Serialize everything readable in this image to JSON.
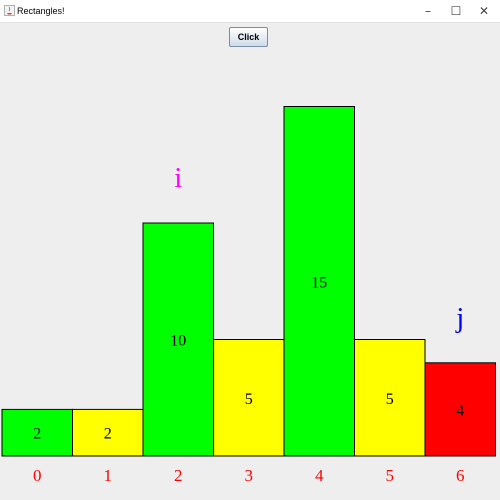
{
  "window": {
    "title": "Rectangles!",
    "minimize_glyph": "–",
    "maximize_glyph": "☐",
    "close_glyph": "✕"
  },
  "toolbar": {
    "click_label": "Click"
  },
  "colors": {
    "green": "#00ff00",
    "yellow": "#ffff00",
    "red": "#ff0000",
    "index_label": "#ff0000",
    "pointer_i": "#ff00ff",
    "pointer_j": "#0000ff",
    "bar_text": "#000000"
  },
  "bars": [
    {
      "index": "0",
      "value": 2,
      "color": "green"
    },
    {
      "index": "1",
      "value": 2,
      "color": "yellow"
    },
    {
      "index": "2",
      "value": 10,
      "color": "green"
    },
    {
      "index": "3",
      "value": 5,
      "color": "yellow"
    },
    {
      "index": "4",
      "value": 15,
      "color": "green"
    },
    {
      "index": "5",
      "value": 5,
      "color": "yellow"
    },
    {
      "index": "6",
      "value": 4,
      "color": "red"
    }
  ],
  "pointers": [
    {
      "label": "i",
      "at_index": 2,
      "color": "pointer_i"
    },
    {
      "label": "j",
      "at_index": 6,
      "color": "pointer_j"
    }
  ]
}
